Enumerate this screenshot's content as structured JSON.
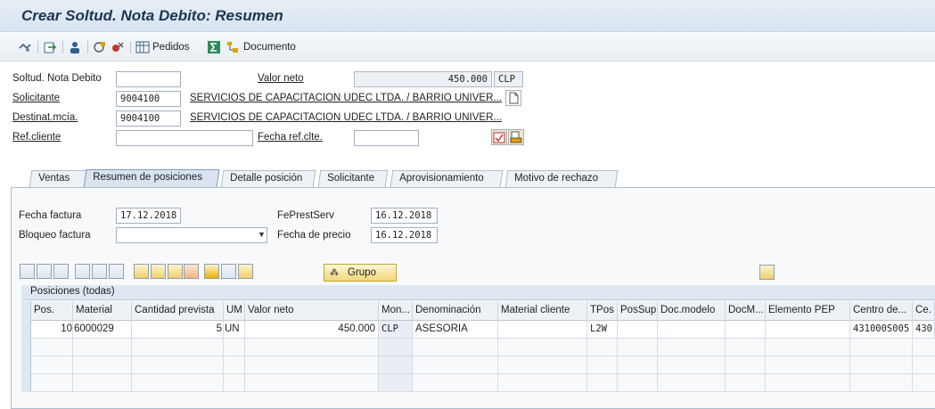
{
  "title": "Crear Soltud. Nota Debito: Resumen",
  "toolbar": {
    "pedidos_label": "Pedidos",
    "documento_label": "Documento"
  },
  "header": {
    "soltud_label": "Soltud. Nota Debito",
    "soltud_value": "",
    "valor_neto_label": "Valor neto",
    "valor_neto_value": "450.000",
    "currency": "CLP",
    "solicitante_label": "Solicitante",
    "solicitante_value": "9004100",
    "solicitante_name": "SERVICIOS DE CAPACITACION UDEC LTDA. / BARRIO UNIVER...",
    "destinat_label": "Destinat.mcía.",
    "destinat_value": "9004100",
    "destinat_name": "SERVICIOS DE CAPACITACION UDEC LTDA. / BARRIO UNIVER...",
    "refcliente_label": "Ref.cliente",
    "refcliente_value": "",
    "fecharef_label": "Fecha ref.clte.",
    "fecharef_value": ""
  },
  "tabs": [
    {
      "label": "Ventas"
    },
    {
      "label": "Resumen de posiciones"
    },
    {
      "label": "Detalle posición"
    },
    {
      "label": "Solicitante"
    },
    {
      "label": "Aprovisionamiento"
    },
    {
      "label": "Motivo de rechazo"
    }
  ],
  "panel": {
    "fecha_factura_label": "Fecha factura",
    "fecha_factura_value": "17.12.2018",
    "fepreststerv_label": "FePrestServ",
    "fepreststerv_value": "16.12.2018",
    "bloqueo_label": "Bloqueo factura",
    "bloqueo_value": "",
    "fecha_precio_label": "Fecha de precio",
    "fecha_precio_value": "16.12.2018",
    "grupo_label": "Grupo"
  },
  "table": {
    "caption": "Posiciones (todas)",
    "columns": [
      "Pos.",
      "Material",
      "Cantidad prevista",
      "UM",
      "Valor neto",
      "Mon...",
      "Denominación",
      "Material cliente",
      "TPos",
      "PosSup",
      "Doc.modelo",
      "DocM...",
      "Elemento PEP",
      "Centro de...",
      "Ce."
    ],
    "rows": [
      [
        "10",
        "6000029",
        "5",
        "UN",
        "450.000",
        "CLP",
        "ASESORIA",
        "",
        "L2W",
        "",
        "",
        "",
        "",
        "431000S005",
        "430"
      ]
    ]
  },
  "colors": {
    "title": "#1d3552",
    "toolbar_bg": "#e9eef4",
    "active_tab": "#d9e4f0"
  }
}
